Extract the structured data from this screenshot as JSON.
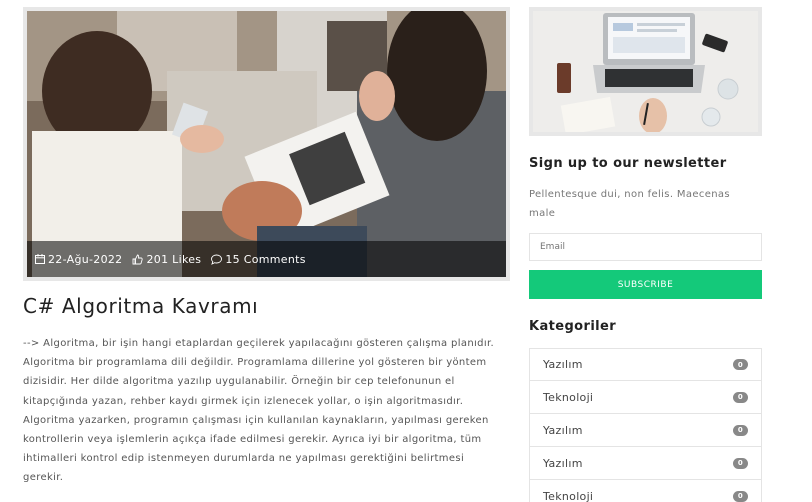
{
  "post": {
    "date": "22-Ağu-2022",
    "likes": "201 Likes",
    "comments": "15 Comments",
    "title": "C# Algoritma Kavramı",
    "body": "--> Algoritma, bir işin hangi etaplardan geçilerek yapılacağını gösteren çalışma planıdır. Algoritma bir programlama dili değildir. Programlama dillerine yol gösteren bir yöntem dizisidir. Her dilde algoritma yazılıp uygulanabilir. Örneğin bir cep telefonunun el kitapçığında yazan, rehber kaydı girmek için izlenecek yollar, o işin algoritmasıdır. Algoritma yazarken, programın çalışması için kullanılan kaynakların, yapılması gereken kontrollerin veya işlemlerin açıkça ifade edilmesi gerekir. Ayrıca iyi bir algoritma, tüm ihtimalleri kontrol edip istenmeyen durumlarda ne yapılması gerektiğini belirtmesi gerekir."
  },
  "newsletter": {
    "title": "Sign up to our newsletter",
    "text": "Pellentesque dui, non felis. Maecenas male",
    "email_placeholder": "Email",
    "subscribe_label": "SUBSCRIBE",
    "accent_color": "#14c97a"
  },
  "categories": {
    "title": "Kategoriler",
    "items": [
      {
        "label": "Yazılım",
        "count": "0"
      },
      {
        "label": "Teknoloji",
        "count": "0"
      },
      {
        "label": "Yazılım",
        "count": "0"
      },
      {
        "label": "Yazılım",
        "count": "0"
      },
      {
        "label": "Teknoloji",
        "count": "0"
      }
    ]
  },
  "icons": {
    "date": "calendar-icon",
    "likes": "thumbs-up-icon",
    "comments": "comment-icon"
  }
}
